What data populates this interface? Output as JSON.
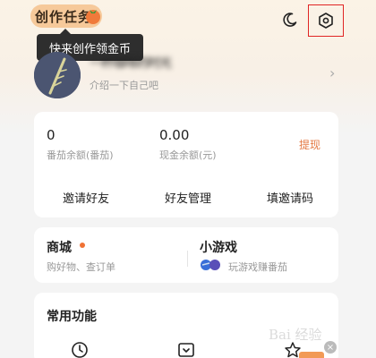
{
  "header": {
    "badge_text": "创作任务",
    "tooltip_text": "快来创作领金币",
    "icons": [
      "moon-icon",
      "settings-icon"
    ]
  },
  "profile": {
    "username": "一杯咖啡的时光",
    "bio": "介绍一下自己吧"
  },
  "wallet": {
    "tomato_balance_value": "0",
    "tomato_balance_label": "番茄余额(番茄)",
    "cash_balance_value": "0.00",
    "cash_balance_label": "现金余额(元)",
    "withdraw_label": "提现",
    "actions": [
      "邀请好友",
      "好友管理",
      "填邀请码"
    ]
  },
  "shop": {
    "title": "商城",
    "subtitle": "购好物、查订单"
  },
  "games": {
    "title": "小游戏",
    "subtitle": "玩游戏赚番茄"
  },
  "common": {
    "title": "常用功能"
  },
  "watermark": {
    "text": "Bai 经验"
  },
  "colors": {
    "accent": "#e47a44",
    "badge_bg": "#f6c99a",
    "highlight_border": "#e02424",
    "tooltip_bg": "#2e2e2e"
  }
}
